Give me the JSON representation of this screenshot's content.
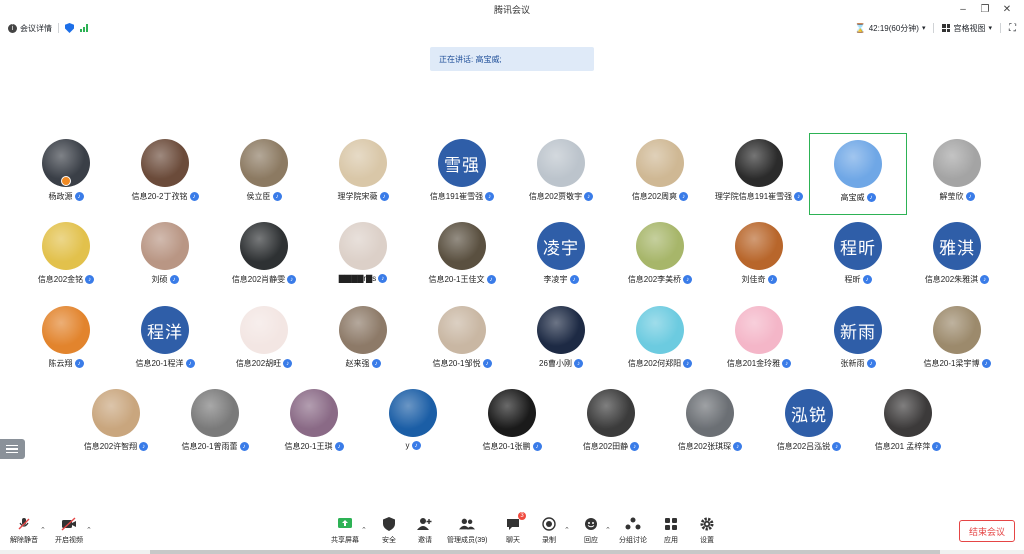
{
  "window": {
    "title": "腾讯会议"
  },
  "topbar": {
    "meeting_info": "会议详情",
    "timer": "42:19(60分钟)",
    "view_mode": "宫格视图"
  },
  "speaking": {
    "text": "正在讲话: 高宝威;"
  },
  "participants": [
    {
      "name": "杨政源",
      "type": "photo",
      "color": "#3a3f47",
      "host": true
    },
    {
      "name": "信息20-2丁孜铭",
      "type": "photo",
      "color": "#6b4b3a"
    },
    {
      "name": "侯立臣",
      "type": "photo",
      "color": "#8c7a62"
    },
    {
      "name": "理学院宋薇",
      "type": "photo",
      "color": "#d9c7a8"
    },
    {
      "name": "信息191崔雪强",
      "type": "text",
      "initials": "雪强"
    },
    {
      "name": "信息202贾敬宇",
      "type": "photo",
      "color": "#bcc4cc"
    },
    {
      "name": "信息202周爽",
      "type": "photo",
      "color": "#cfb894"
    },
    {
      "name": "理学院信息191崔雪强",
      "type": "photo",
      "color": "#2b2b2b"
    },
    {
      "name": "高宝威",
      "type": "photo",
      "color": "#6fa7e6",
      "active": true
    },
    {
      "name": "解莹欣",
      "type": "photo",
      "color": "#a4a4a4"
    },
    {
      "name": "信息202金铭",
      "type": "photo",
      "color": "#e2c14c"
    },
    {
      "name": "刘硕",
      "type": "photo",
      "color": "#b99684"
    },
    {
      "name": "信息202肖静雯",
      "type": "photo",
      "color": "#2e3133"
    },
    {
      "name": "▇▇▇▇r▇s",
      "type": "photo",
      "color": "#dcd0c8"
    },
    {
      "name": "信息20-1王佳文",
      "type": "photo",
      "color": "#5a5040"
    },
    {
      "name": "李凌宇",
      "type": "text",
      "initials": "凌宇"
    },
    {
      "name": "信息202李美桥",
      "type": "photo",
      "color": "#a7b66a"
    },
    {
      "name": "刘佳奇",
      "type": "photo",
      "color": "#b8662b"
    },
    {
      "name": "程昕",
      "type": "text",
      "initials": "程昕"
    },
    {
      "name": "信息202朱雅淇",
      "type": "text",
      "initials": "雅淇"
    },
    {
      "name": "陈云翔",
      "type": "photo",
      "color": "#e2842d"
    },
    {
      "name": "信息20-1程洋",
      "type": "text",
      "initials": "程洋"
    },
    {
      "name": "信息202胡旺",
      "type": "photo",
      "color": "#f3e6e3"
    },
    {
      "name": "赵来强",
      "type": "photo",
      "color": "#8d7a68"
    },
    {
      "name": "信息20-1邹悦",
      "type": "photo",
      "color": "#c9b7a3"
    },
    {
      "name": "26曹小刚",
      "type": "photo",
      "color": "#1d2a44"
    },
    {
      "name": "信息202何郑阳",
      "type": "photo",
      "color": "#6ccbe0"
    },
    {
      "name": "信息201金玲雅",
      "type": "photo",
      "color": "#f4b6c8"
    },
    {
      "name": "张新雨",
      "type": "text",
      "initials": "新雨"
    },
    {
      "name": "信息20-1梁宇博",
      "type": "photo",
      "color": "#9c8a6c"
    },
    {
      "name": "信息202许智翔",
      "type": "photo",
      "color": "#c9a67e"
    },
    {
      "name": "信息20-1曾雨蕾",
      "type": "photo",
      "color": "#7a7a7a"
    },
    {
      "name": "信息20-1王琪",
      "type": "photo",
      "color": "#8a6a86"
    },
    {
      "name": "y",
      "type": "photo",
      "color": "#1b5ea6"
    },
    {
      "name": "信息20-1张鹏",
      "type": "photo",
      "color": "#1a1a1a"
    },
    {
      "name": "信息202田静",
      "type": "photo",
      "color": "#3b3b3b"
    },
    {
      "name": "信息202张琪琛",
      "type": "photo",
      "color": "#6b6f74"
    },
    {
      "name": "信息202吕泓锐",
      "type": "text",
      "initials": "泓锐"
    },
    {
      "name": "信息201 孟梓萍",
      "type": "photo",
      "color": "#3c3a3a"
    }
  ],
  "toolbar": {
    "unmute": "解除静音",
    "start_video": "开启视频",
    "share_screen": "共享屏幕",
    "security": "安全",
    "invite": "邀请",
    "members": "管理成员(39)",
    "chat": "聊天",
    "chat_badge": "3",
    "record": "录制",
    "reactions": "回应",
    "breakout": "分组讨论",
    "apps": "应用",
    "settings": "设置",
    "end_meeting": "结束会议"
  },
  "colors": {
    "accent": "#1d6fe8",
    "text_avatar": "#2f5ea8",
    "active_border": "#2db255",
    "danger": "#e54545"
  }
}
